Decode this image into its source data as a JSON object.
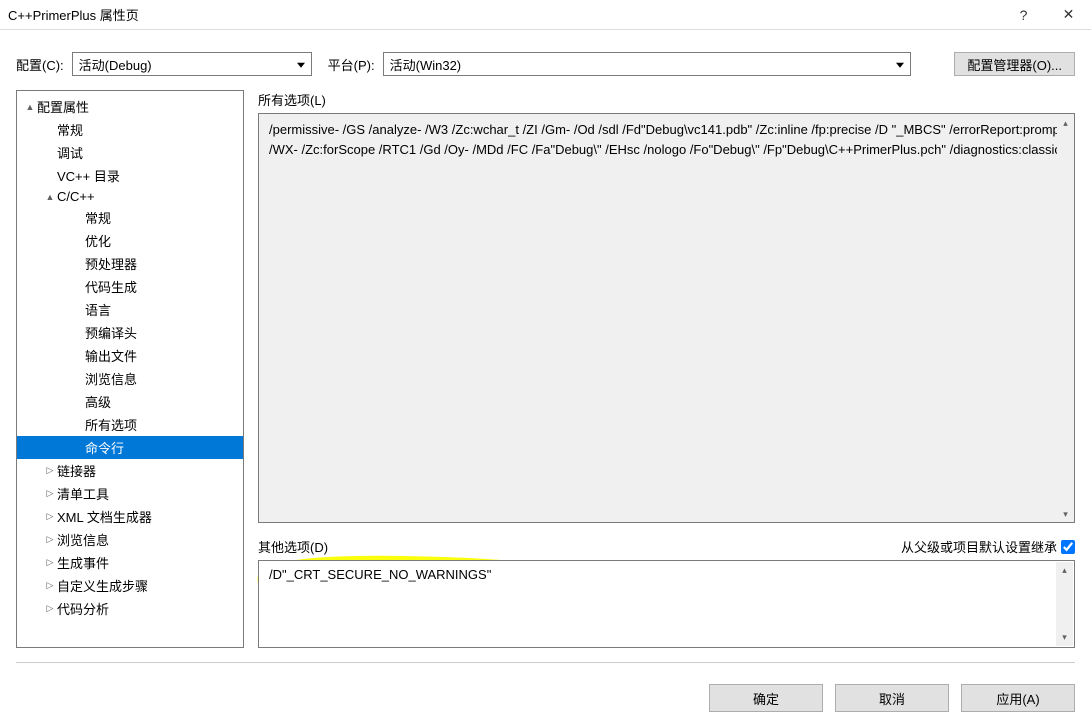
{
  "window": {
    "title": "C++PrimerPlus 属性页",
    "help": "?",
    "close": "✕"
  },
  "config": {
    "config_label": "配置(C):",
    "config_value": "活动(Debug)",
    "platform_label": "平台(P):",
    "platform_value": "活动(Win32)",
    "cfg_mgr": "配置管理器(O)..."
  },
  "tree": {
    "items": [
      {
        "level": 0,
        "tri": "▲",
        "label": "配置属性"
      },
      {
        "level": 1,
        "tri": "",
        "label": "常规"
      },
      {
        "level": 1,
        "tri": "",
        "label": "调试"
      },
      {
        "level": 1,
        "tri": "",
        "label": "VC++ 目录"
      },
      {
        "level": 1,
        "tri": "▲",
        "label": "C/C++"
      },
      {
        "level": 2,
        "tri": "",
        "label": "常规"
      },
      {
        "level": 2,
        "tri": "",
        "label": "优化"
      },
      {
        "level": 2,
        "tri": "",
        "label": "预处理器"
      },
      {
        "level": 2,
        "tri": "",
        "label": "代码生成"
      },
      {
        "level": 2,
        "tri": "",
        "label": "语言"
      },
      {
        "level": 2,
        "tri": "",
        "label": "预编译头"
      },
      {
        "level": 2,
        "tri": "",
        "label": "输出文件"
      },
      {
        "level": 2,
        "tri": "",
        "label": "浏览信息"
      },
      {
        "level": 2,
        "tri": "",
        "label": "高级"
      },
      {
        "level": 2,
        "tri": "",
        "label": "所有选项"
      },
      {
        "level": 2,
        "tri": "",
        "label": "命令行",
        "selected": true
      },
      {
        "level": 1,
        "tri": "▷",
        "label": "链接器"
      },
      {
        "level": 1,
        "tri": "▷",
        "label": "清单工具"
      },
      {
        "level": 1,
        "tri": "▷",
        "label": "XML 文档生成器"
      },
      {
        "level": 1,
        "tri": "▷",
        "label": "浏览信息"
      },
      {
        "level": 1,
        "tri": "▷",
        "label": "生成事件"
      },
      {
        "level": 1,
        "tri": "▷",
        "label": "自定义生成步骤"
      },
      {
        "level": 1,
        "tri": "▷",
        "label": "代码分析"
      }
    ]
  },
  "right": {
    "all_options_label": "所有选项(L)",
    "all_options_value": "/permissive- /GS /analyze- /W3 /Zc:wchar_t /ZI /Gm- /Od /sdl /Fd\"Debug\\vc141.pdb\" /Zc:inline /fp:precise /D \"_MBCS\" /errorReport:prompt /WX- /Zc:forScope /RTC1 /Gd /Oy- /MDd /FC /Fa\"Debug\\\" /EHsc /nologo /Fo\"Debug\\\" /Fp\"Debug\\C++PrimerPlus.pch\" /diagnostics:classic ",
    "other_options_label": "其他选项(D)",
    "inherit_label": "从父级或项目默认设置继承",
    "inherit_checked": true,
    "other_options_value": "/D\"_CRT_SECURE_NO_WARNINGS\""
  },
  "buttons": {
    "ok": "确定",
    "cancel": "取消",
    "apply": "应用(A)"
  }
}
